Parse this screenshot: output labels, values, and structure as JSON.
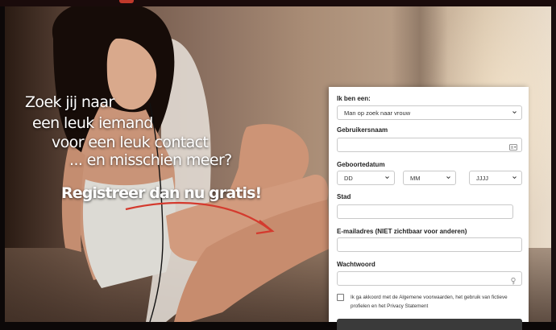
{
  "hero": {
    "lines": [
      "Zoek jij naar",
      "een leuk iemand",
      "voor een leuk contact",
      "... en misschien meer?"
    ],
    "cta": "Registreer dan nu gratis!"
  },
  "form": {
    "iam_label": "Ik ben een:",
    "iam_value": "Man op zoek naar vrouw",
    "username_label": "Gebruikersnaam",
    "username_value": "",
    "birthdate_label": "Geboortedatum",
    "day_value": "DD",
    "month_value": "MM",
    "year_value": "JJJJ",
    "city_label": "Stad",
    "city_value": "",
    "email_label": "E-mailadres (NIET zichtbaar voor anderen)",
    "email_value": "",
    "password_label": "Wachtwoord",
    "password_value": "",
    "terms_text": "Ik ga akkoord met de Algemene voorwaarden, het gebruik van fictieve profielen en het Privacy Statement"
  },
  "colors": {
    "accent": "#c0392b",
    "arrow": "#d43a2e",
    "form_bg": "#ffffff",
    "field_border": "#c9c9c9"
  }
}
